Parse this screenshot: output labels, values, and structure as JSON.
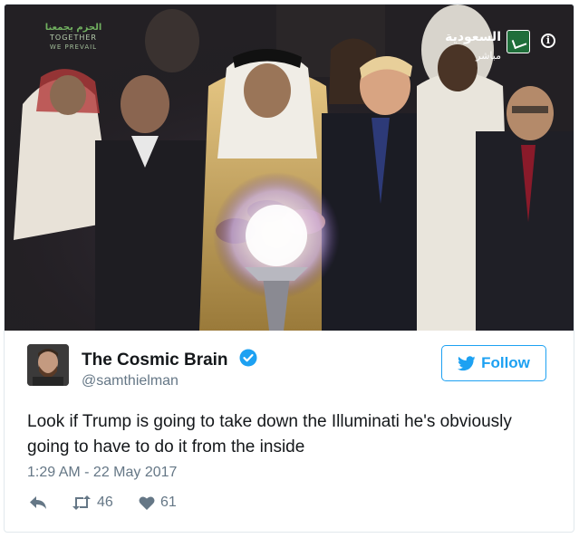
{
  "media": {
    "channel_name": "السعودية",
    "channel_live": "مباشر",
    "banner_line1": "الحزم يجمعنا",
    "banner_line2": "TOGETHER",
    "banner_line3": "WE PREVAIL",
    "info_glyph": "i"
  },
  "tweet": {
    "author_name": "The Cosmic Brain",
    "author_handle": "@samthielman",
    "follow_label": "Follow",
    "text": "Look if Trump is going to take down the Illuminati he's obviously going to have to do it from the inside",
    "timestamp": "1:29 AM - 22 May 2017",
    "retweets": "46",
    "likes": "61"
  },
  "colors": {
    "brand_blue": "#1da1f2",
    "secondary_text": "#657786",
    "primary_text": "#14171a",
    "border": "#e1e8ed",
    "like_icon": "#657786"
  },
  "icons": {
    "verified": "verified-badge-icon",
    "follow": "twitter-bird-icon",
    "reply": "reply-icon",
    "retweet": "retweet-icon",
    "like": "heart-icon",
    "info": "info-icon"
  }
}
